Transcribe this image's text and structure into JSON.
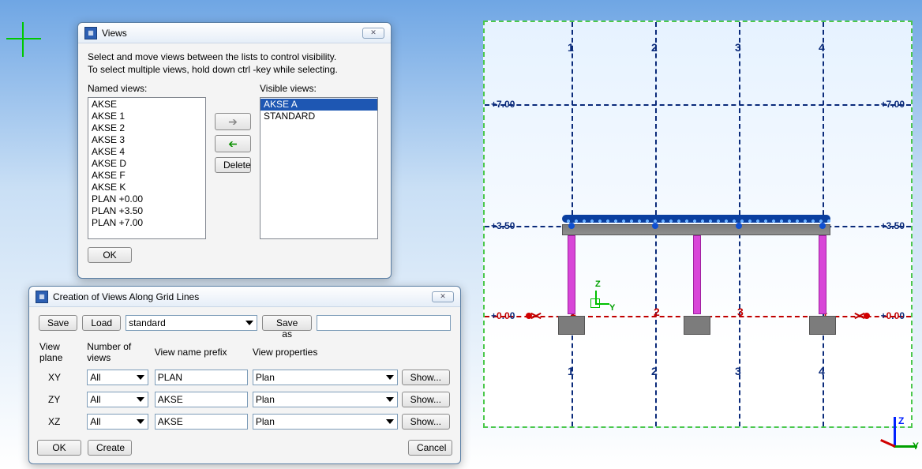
{
  "views_dialog": {
    "title": "Views",
    "instructions_line1": "Select and move views between the lists to control visibility.",
    "instructions_line2": "To select multiple views, hold down ctrl -key while selecting.",
    "named_views_label": "Named views:",
    "visible_views_label": "Visible views:",
    "named_views": [
      "AKSE",
      "AKSE 1",
      "AKSE 2",
      "AKSE 3",
      "AKSE 4",
      "AKSE D",
      "AKSE F",
      "AKSE K",
      "PLAN +0.00",
      "PLAN +3.50",
      "PLAN +7.00"
    ],
    "visible_views": [
      "AKSE A",
      "STANDARD"
    ],
    "selected_visible_index": 0,
    "delete_label": "Delete",
    "ok_label": "OK"
  },
  "grid_dialog": {
    "title": "Creation of Views Along Grid Lines",
    "save_label": "Save",
    "load_label": "Load",
    "settings_name": "standard",
    "save_as_label": "Save as",
    "save_as_value": "",
    "col_headers": {
      "plane": "View plane",
      "num": "Number of views",
      "prefix": "View name prefix",
      "props": "View properties"
    },
    "rows": [
      {
        "plane": "XY",
        "num": "All",
        "prefix": "PLAN",
        "props": "Plan",
        "show": "Show..."
      },
      {
        "plane": "ZY",
        "num": "All",
        "prefix": "AKSE",
        "props": "Plan",
        "show": "Show..."
      },
      {
        "plane": "XZ",
        "num": "All",
        "prefix": "AKSE",
        "props": "Plan",
        "show": "Show..."
      }
    ],
    "ok_label": "OK",
    "create_label": "Create",
    "cancel_label": "Cancel"
  },
  "viewport": {
    "grid_numbers_top": [
      "1",
      "2",
      "3",
      "4"
    ],
    "grid_numbers_bottom": [
      "1",
      "2",
      "3",
      "4"
    ],
    "elev_left": [
      "+7.00",
      "+3.50",
      "+0.00"
    ],
    "elev_right": [
      "+7.00",
      "+3.50",
      "+0.00"
    ],
    "axis_mid_labels": {
      "z": "Z",
      "y": "Y",
      "one": "1",
      "two": "2",
      "three": "3",
      "four": "4"
    },
    "triad": {
      "z": "Z",
      "y": "Y"
    }
  }
}
